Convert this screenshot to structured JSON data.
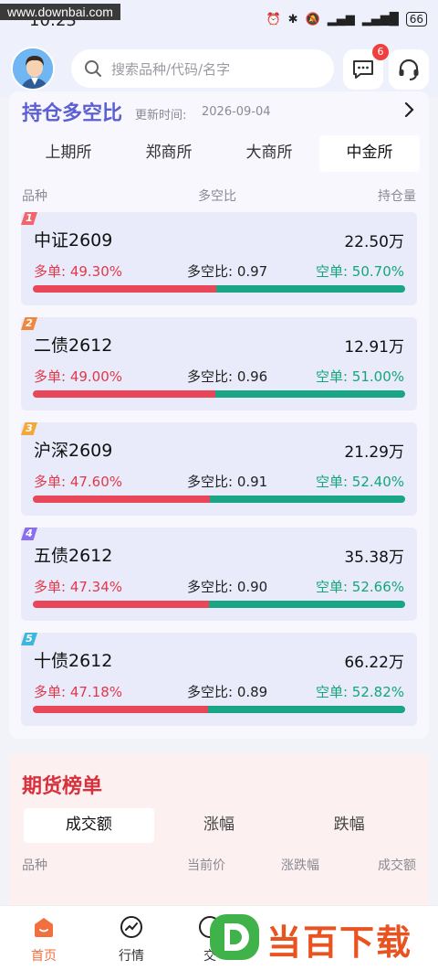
{
  "status_bar": {
    "time": "10:23",
    "watermark": "www.downbai.com",
    "battery": "66"
  },
  "header": {
    "search_placeholder": "搜索品种/代码/名字",
    "message_badge": "6"
  },
  "long_short": {
    "title": "持仓多空比",
    "update_label": "更新时间:",
    "update_date": "2026-09-04",
    "tabs": [
      {
        "label": "上期所",
        "active": false
      },
      {
        "label": "郑商所",
        "active": false
      },
      {
        "label": "大商所",
        "active": false
      },
      {
        "label": "中金所",
        "active": true
      }
    ],
    "columns": {
      "variety": "品种",
      "ratio": "多空比",
      "position": "持仓量"
    },
    "rows": [
      {
        "rank": "1",
        "name": "中证2609",
        "volume": "22.50万",
        "long": "多单: 49.30%",
        "ratio": "多空比: 0.97",
        "short": "空单: 50.70%",
        "long_pct": 49.3,
        "rank_color": "#f0666f"
      },
      {
        "rank": "2",
        "name": "二债2612",
        "volume": "12.91万",
        "long": "多单: 49.00%",
        "ratio": "多空比: 0.96",
        "short": "空单: 51.00%",
        "long_pct": 49.0,
        "rank_color": "#f0873a"
      },
      {
        "rank": "3",
        "name": "沪深2609",
        "volume": "21.29万",
        "long": "多单: 47.60%",
        "ratio": "多空比: 0.91",
        "short": "空单: 52.40%",
        "long_pct": 47.6,
        "rank_color": "#f3a93a"
      },
      {
        "rank": "4",
        "name": "五债2612",
        "volume": "35.38万",
        "long": "多单: 47.34%",
        "ratio": "多空比: 0.90",
        "short": "空单: 52.66%",
        "long_pct": 47.34,
        "rank_color": "#8b6df0"
      },
      {
        "rank": "5",
        "name": "十债2612",
        "volume": "66.22万",
        "long": "多单: 47.18%",
        "ratio": "多空比: 0.89",
        "short": "空单: 52.82%",
        "long_pct": 47.18,
        "rank_color": "#3bb6dd"
      }
    ]
  },
  "futures_ranking": {
    "title": "期货榜单",
    "tabs": [
      {
        "label": "成交额",
        "active": true
      },
      {
        "label": "涨幅",
        "active": false
      },
      {
        "label": "跌幅",
        "active": false
      }
    ],
    "columns": {
      "variety": "品种",
      "price": "当前价",
      "change": "涨跌幅",
      "turnover": "成交额"
    }
  },
  "bottom_nav": [
    {
      "label": "首页",
      "active": true
    },
    {
      "label": "行情",
      "active": false
    },
    {
      "label": "交",
      "active": false
    }
  ],
  "watermark_logo": "当百下载",
  "colors": {
    "accent": "#5b5fd3",
    "long": "#e8475a",
    "short": "#1aa584",
    "ranking_title": "#d8313e",
    "nav_active": "#f07040"
  }
}
